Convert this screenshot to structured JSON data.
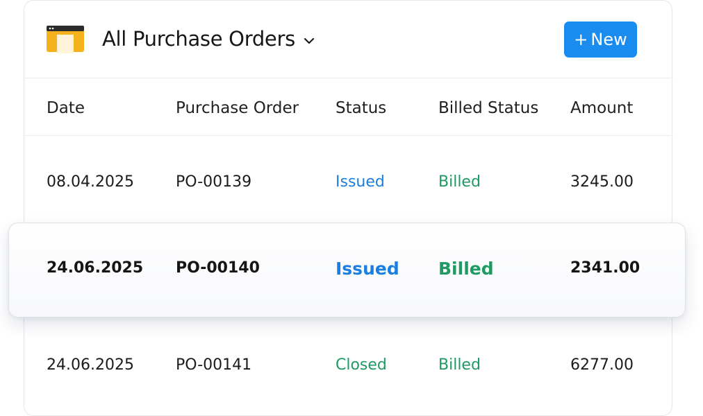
{
  "header": {
    "title": "All Purchase Orders",
    "new_button": "New",
    "new_button_icon": "plus-icon"
  },
  "columns": [
    "Date",
    "Purchase Order",
    "Status",
    "Billed Status",
    "Amount"
  ],
  "rows": [
    {
      "date": "08.04.2025",
      "po": "PO-00139",
      "status": "Issued",
      "billed": "Billed",
      "amount": "3245.00"
    },
    {
      "date": "24.06.2025",
      "po": "PO-00140",
      "status": "Issued",
      "billed": "Billed",
      "amount": "2341.00"
    },
    {
      "date": "24.06.2025",
      "po": "PO-00141",
      "status": "Closed",
      "billed": "Billed",
      "amount": "6277.00"
    }
  ],
  "colors": {
    "accent": "#1a8cf0",
    "status_issued": "#1a7fe0",
    "status_closed": "#1f9a62",
    "billed": "#1f9a62",
    "icon_yellow": "#f5b21c"
  }
}
